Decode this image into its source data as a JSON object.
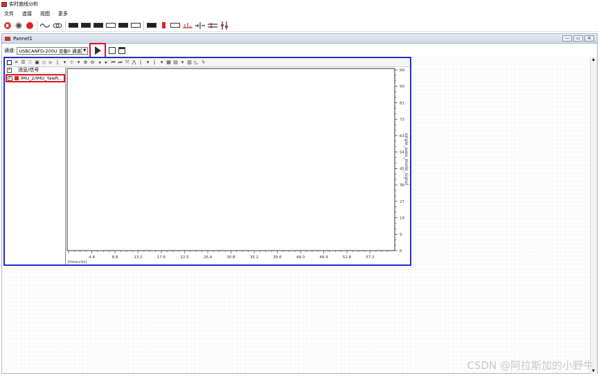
{
  "window": {
    "title": "实时曲线分析"
  },
  "menu": [
    "文件",
    "连接",
    "视图",
    "更多"
  ],
  "toolbar": {
    "icons": [
      "rewind-icon",
      "record-icon",
      "stop-record-icon",
      "waveform-icon",
      "link-icon",
      "can-box-icon",
      "can-box2-icon",
      "can-box3-icon",
      "bus-icon",
      "can-filled-icon",
      "can-outline-icon",
      "box-icon",
      "frame-icon",
      "red-box-icon",
      "signal-icon",
      "divider-icon",
      "tx-icon",
      "rx-icon",
      "step-icon",
      "plug-icon"
    ]
  },
  "panel": {
    "title": "Pannel1",
    "channel_label": "通道:",
    "channel_value": "USBCANFD-200U 设备0 通道0"
  },
  "signal_list": {
    "header": "消息/信号",
    "items": [
      {
        "label": "IMU_2/IMU_YawR...",
        "color": "#e02020",
        "checked": true
      }
    ]
  },
  "chart_data": {
    "type": "line",
    "x_ticks": [
      "4.4",
      "8.8",
      "13.2",
      "17.6",
      "22.0",
      "26.4",
      "30.8",
      "35.2",
      "39.6",
      "44.0",
      "48.4",
      "52.8",
      "57.2"
    ],
    "x_start_label": "[time+0s]",
    "y_ticks": [
      "99",
      "90",
      "81",
      "72",
      "63",
      "54",
      "45",
      "36",
      "27",
      "18",
      "9",
      "0"
    ],
    "ylabel": "single_axes_mode_signal",
    "ylim": [
      0,
      99
    ],
    "series": [
      {
        "name": "IMU_2/IMU_YawR...",
        "color": "#e02020",
        "values": []
      }
    ]
  },
  "watermark": "CSDN @阿拉斯加的小野牛"
}
